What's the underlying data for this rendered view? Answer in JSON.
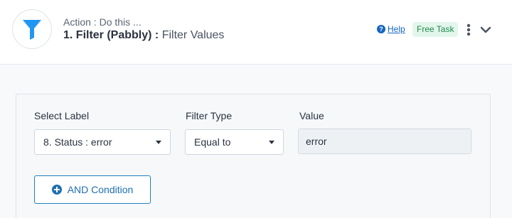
{
  "header": {
    "subtitle": "Action : Do this ...",
    "title_app": "1. Filter (Pabbly)",
    "title_separator": " : ",
    "title_action": "Filter Values",
    "help_label": "Help",
    "badge_label": "Free Task",
    "icon": "filter-funnel-icon"
  },
  "filter": {
    "select_label_heading": "Select Label",
    "select_label_value": "8. Status : error",
    "filter_type_heading": "Filter Type",
    "filter_type_value": "Equal to",
    "value_heading": "Value",
    "value_input": "error"
  },
  "actions": {
    "and_condition_label": "AND Condition"
  },
  "colors": {
    "accent": "#1e6fb0",
    "funnel": "#2196f3",
    "badge_bg": "#e3f6ec",
    "badge_text": "#1f8a4c"
  }
}
